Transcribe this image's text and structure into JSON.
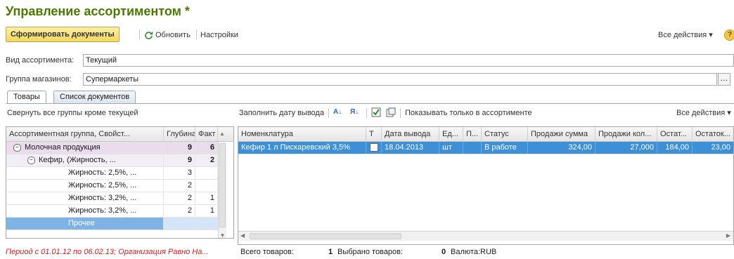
{
  "window": {
    "title": "Управление ассортиментом *"
  },
  "toolbar": {
    "generate_docs": "Сформировать документы",
    "refresh": "Обновить",
    "settings": "Настройки",
    "all_actions": "Все действия ▾"
  },
  "form": {
    "assortment_kind_label": "Вид ассортимента:",
    "assortment_kind_value": "Текущий",
    "store_group_label": "Группа магазинов:",
    "store_group_value": "Супермаркеты"
  },
  "tabs": [
    {
      "label": "Товары"
    },
    {
      "label": "Список документов"
    }
  ],
  "left": {
    "collapse_link": "Свернуть все группы кроме текущей",
    "columns": [
      "Ассортиментная группа, Свойст...",
      "Глубина",
      "Факт"
    ],
    "rows": [
      {
        "name": "Молочная продукция",
        "depth": "9",
        "fact": "6"
      },
      {
        "name": "Кефир, (Жирность, ...",
        "depth": "9",
        "fact": "2"
      },
      {
        "name": "Жирность: 2,5%, ...",
        "depth": "3",
        "fact": ""
      },
      {
        "name": "Жирность: 2,5%, ...",
        "depth": "2",
        "fact": ""
      },
      {
        "name": "Жирность: 3,2%, ...",
        "depth": "2",
        "fact": "1"
      },
      {
        "name": "Жирность: 3,2%, ...",
        "depth": "2",
        "fact": "1"
      },
      {
        "name": "Прочее",
        "depth": "",
        "fact": ""
      }
    ]
  },
  "right": {
    "fill_date": "Заполнить дату вывода",
    "show_only": "Показывать только в ассортименте",
    "all_actions": "Все действия ▾",
    "columns": [
      "Номенклатура",
      "Т",
      "Дата вывода",
      "Ед...",
      "П...",
      "Статус",
      "Продажи сумма",
      "Продажи кол...",
      "Остат...",
      "Остаток..."
    ],
    "rows": [
      {
        "item": "Кефир 1 л Пискаревский 3,5%",
        "date": "18.04.2013",
        "unit": "шт",
        "p": "",
        "status": "В работе",
        "sales_sum": "324,00",
        "sales_qty": "27,000",
        "rest1": "184,00",
        "rest2": "23,00"
      }
    ]
  },
  "status": {
    "period": "Период с 01.01.12 по 06.02.13; Организация Равно На...",
    "total_label": "Всего товаров:",
    "total_value": "1",
    "selected_label": "Выбрано товаров:",
    "selected_value": "0",
    "currency_label": "Валюта:",
    "currency_value": "RUB"
  },
  "colors": {
    "title": "#4a7a00",
    "primary_button": "#f2d85a",
    "selected_row": "#3d8fd6",
    "period_text": "#d01c1c"
  }
}
